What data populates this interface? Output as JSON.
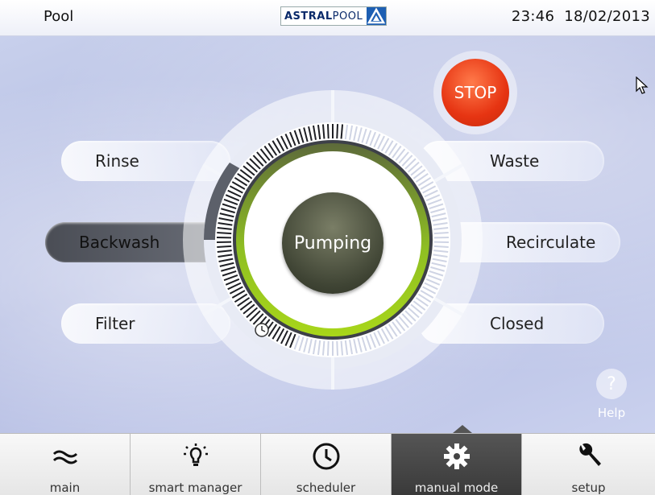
{
  "header": {
    "location": "Pool",
    "brand_bold": "ASTRAL",
    "brand_light": "POOL",
    "time": "23:46",
    "date": "18/02/2013"
  },
  "valve_positions": {
    "left": [
      "Rinse",
      "Backwash",
      "Filter"
    ],
    "right": [
      "Waste",
      "Recirculate",
      "Closed"
    ],
    "selected": "Backwash"
  },
  "center_status": "Pumping",
  "stop_label": "STOP",
  "help": {
    "icon": "?",
    "label": "Help"
  },
  "nav": [
    {
      "label": "main",
      "icon": "waves-icon"
    },
    {
      "label": "smart manager",
      "icon": "lightbulb-icon"
    },
    {
      "label": "scheduler",
      "icon": "clock-icon"
    },
    {
      "label": "manual mode",
      "icon": "gear-icon",
      "active": true
    },
    {
      "label": "setup",
      "icon": "wrench-icon"
    }
  ],
  "colors": {
    "stop": "#e63412",
    "progress_arc": "#9ccf1e",
    "active_nav": "#444444",
    "selected_valve": "#4a4d55"
  }
}
